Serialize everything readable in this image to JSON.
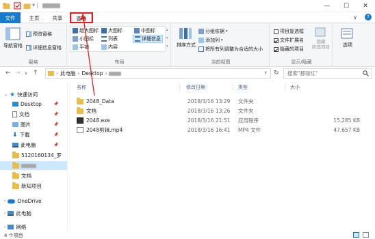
{
  "window": {
    "title_path": "",
    "controls": {
      "minimize": "—",
      "maximize": "☐",
      "close": "✕"
    }
  },
  "ribbon": {
    "tabs": {
      "file": "文件",
      "home": "主页",
      "share": "共享",
      "view": "查看"
    },
    "panes": {
      "nav_pane": "导航窗格",
      "preview_pane": "预览窗格",
      "details_pane": "详细信息窗格",
      "group_label": "窗格"
    },
    "layout": {
      "extra_large": "超大图标",
      "large": "大图标",
      "medium": "中图标",
      "small": "小图标",
      "list": "列表",
      "details": "详细信息",
      "tiles": "平铺",
      "content": "内容",
      "group_label": "布局"
    },
    "current_view": {
      "sort": "排序方式",
      "group_by": "分组依据",
      "add_column": "添加列",
      "size_all": "将所有列调整为合适的大小",
      "group_label": "当前视图"
    },
    "show_hide": {
      "item_checkboxes": "项目复选框",
      "file_extensions": "文件扩展名",
      "hidden_items": "隐藏的项目",
      "hide_selected": "隐藏",
      "hide_selected_sub": "所选项目",
      "group_label": "显示/隐藏"
    },
    "options": "选项",
    "expand_toggle": "∨",
    "help": "?"
  },
  "address": {
    "back": "←",
    "forward": "→",
    "dropdown": "∨",
    "up": "↑",
    "sep": "›",
    "crumbs": [
      "此电脑",
      "Desktop"
    ],
    "refresh": "↻",
    "search_placeholder": "搜索\"都丽红\""
  },
  "nav": {
    "quick_access": "快速访问",
    "items": [
      {
        "label": "Desktop",
        "pinned": "📌"
      },
      {
        "label": "文档",
        "pinned": "📌"
      },
      {
        "label": "图片",
        "pinned": "📌"
      },
      {
        "label": "下载",
        "pinned": "📌"
      },
      {
        "label": "此电脑",
        "pinned": "📌"
      },
      {
        "label": "5120160134_罗",
        "pinned": ""
      },
      {
        "label": "",
        "pinned": ""
      },
      {
        "label": "文档",
        "pinned": ""
      },
      {
        "label": "新知项目",
        "pinned": ""
      }
    ],
    "onedrive": "OneDrive",
    "this_pc": "此电脑",
    "network": "网络"
  },
  "list": {
    "columns": {
      "name": "名称",
      "modified": "修改日期",
      "type": "类型",
      "size": "大小"
    },
    "files": [
      {
        "name": "2048_Data",
        "modified": "2018/3/16 13:29",
        "type": "文件夹",
        "size": ""
      },
      {
        "name": "文档",
        "modified": "2018/3/16 13:26",
        "type": "文件夹",
        "size": ""
      },
      {
        "name": "2048.exe",
        "modified": "2018/3/16 21:51",
        "type": "应用程序",
        "size": "15,285 KB"
      },
      {
        "name": "2048剪辑.mp4",
        "modified": "2018/3/16 16:41",
        "type": "MP4 文件",
        "size": "47,657 KB"
      }
    ]
  },
  "status": {
    "count": "4 个项目"
  },
  "colors": {
    "accent": "#1979ca",
    "highlight": "#e02020",
    "folder": "#e8bd4a",
    "selection": "#cce8ff"
  }
}
